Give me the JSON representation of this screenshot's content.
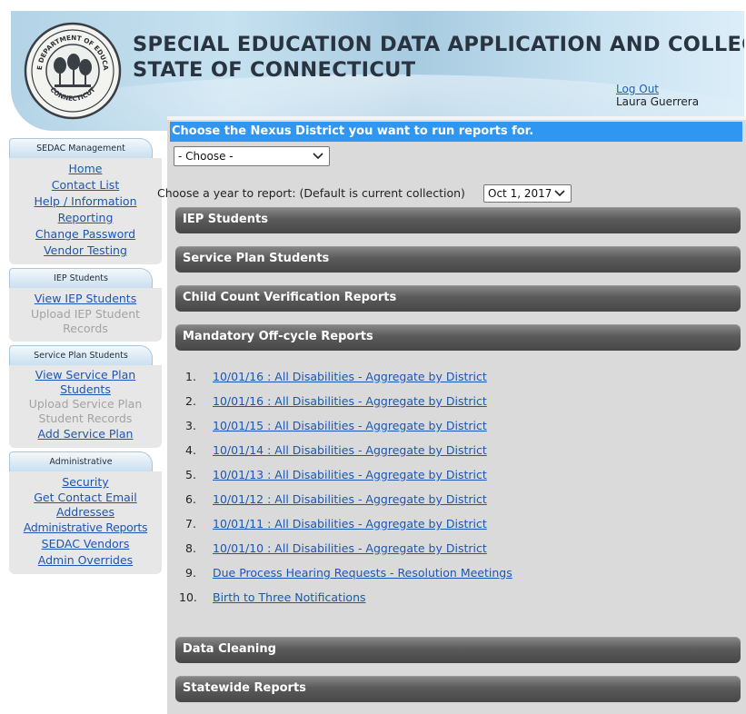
{
  "header": {
    "title_line1": "SPECIAL EDUCATION DATA APPLICATION AND COLLECTION",
    "title_line2": "STATE OF CONNECTICUT",
    "logout_label": "Log Out",
    "user_name": "Laura Guerrera",
    "seal": {
      "top_text": "STATE DEPARTMENT OF EDUCATION",
      "bottom_text": "CONNECTICUT"
    }
  },
  "sidebar": {
    "sections": [
      {
        "tab": "SEDAC Management",
        "items": [
          {
            "label": "Home",
            "enabled": true
          },
          {
            "label": "Contact List",
            "enabled": true
          },
          {
            "label": "Help / Information",
            "enabled": true
          },
          {
            "label": "Reporting",
            "enabled": true
          },
          {
            "label": "Change Password",
            "enabled": true
          },
          {
            "label": "Vendor Testing",
            "enabled": true
          }
        ]
      },
      {
        "tab": "IEP Students",
        "items": [
          {
            "label": "View IEP Students",
            "enabled": true
          },
          {
            "label": "Upload IEP Student Records",
            "enabled": false
          }
        ]
      },
      {
        "tab": "Service Plan Students",
        "items": [
          {
            "label": "View Service Plan Students",
            "enabled": true
          },
          {
            "label": "Upload Service Plan Student Records",
            "enabled": false
          },
          {
            "label": "Add Service Plan",
            "enabled": true
          }
        ]
      },
      {
        "tab": "Administrative",
        "items": [
          {
            "label": "Security",
            "enabled": true
          },
          {
            "label": "Get Contact Email Addresses",
            "enabled": true
          },
          {
            "label": "Administrative Reports",
            "enabled": true
          },
          {
            "label": "SEDAC Vendors",
            "enabled": true
          },
          {
            "label": "Admin Overrides",
            "enabled": true
          }
        ]
      }
    ]
  },
  "main": {
    "nexus_prompt": "Choose the Nexus District you want to run reports for.",
    "district_select": "- Choose -",
    "year_label": "Choose a year to report: (Default is current collection)",
    "year_select": "Oct 1, 2017",
    "sections": [
      "IEP Students",
      "Service Plan Students",
      "Child Count Verification Reports",
      "Mandatory Off-cycle Reports",
      "Data Cleaning",
      "Statewide Reports"
    ],
    "reports": [
      {
        "num": "1.",
        "label": "10/01/16 : All Disabilities - Aggregate by District"
      },
      {
        "num": "2.",
        "label": "10/01/16 : All Disabilities - Aggregate by District"
      },
      {
        "num": "3.",
        "label": "10/01/15 : All Disabilities - Aggregate by District"
      },
      {
        "num": "4.",
        "label": "10/01/14 : All Disabilities - Aggregate by District"
      },
      {
        "num": "5.",
        "label": "10/01/13 : All Disabilities - Aggregate by District"
      },
      {
        "num": "6.",
        "label": "10/01/12 : All Disabilities - Aggregate by District"
      },
      {
        "num": "7.",
        "label": "10/01/11 : All Disabilities - Aggregate by District"
      },
      {
        "num": "8.",
        "label": "10/01/10 : All Disabilities - Aggregate by District"
      },
      {
        "num": "9.",
        "label": "Due Process Hearing Requests - Resolution Meetings"
      },
      {
        "num": "10.",
        "label": "Birth to Three Notifications"
      }
    ]
  },
  "colors": {
    "nexus_bar": "#2f97f2",
    "link": "#1d56b0",
    "section_bar": "#5b5b5b"
  }
}
